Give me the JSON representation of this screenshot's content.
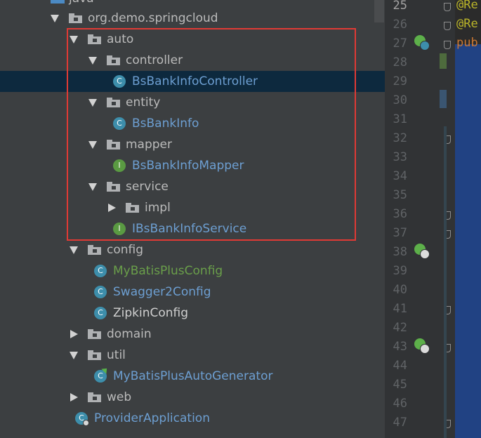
{
  "tree": {
    "top_partial": "java",
    "rows": [
      {
        "label": "org.demo.springcloud",
        "kind": "folder",
        "expanded": true,
        "indent": 0
      },
      {
        "label": "auto",
        "kind": "folder",
        "expanded": true,
        "indent": 1
      },
      {
        "label": "controller",
        "kind": "folder",
        "expanded": true,
        "indent": 2
      },
      {
        "label": "BsBankInfoController",
        "kind": "class",
        "indent": 3,
        "color": "blue",
        "selected": true
      },
      {
        "label": "entity",
        "kind": "folder",
        "expanded": true,
        "indent": 2
      },
      {
        "label": "BsBankInfo",
        "kind": "class",
        "indent": 3,
        "color": "blue"
      },
      {
        "label": "mapper",
        "kind": "folder",
        "expanded": true,
        "indent": 2
      },
      {
        "label": "BsBankInfoMapper",
        "kind": "interface",
        "indent": 3,
        "color": "blue"
      },
      {
        "label": "service",
        "kind": "folder",
        "expanded": true,
        "indent": 2
      },
      {
        "label": "impl",
        "kind": "folder",
        "expanded": false,
        "indent": 3
      },
      {
        "label": "IBsBankInfoService",
        "kind": "interface",
        "indent": 3,
        "color": "blue"
      },
      {
        "label": "config",
        "kind": "folder",
        "expanded": true,
        "indent": 1
      },
      {
        "label": "MyBatisPlusConfig",
        "kind": "class",
        "indent": 2,
        "color": "green"
      },
      {
        "label": "Swagger2Config",
        "kind": "class",
        "indent": 2,
        "color": "blue"
      },
      {
        "label": "ZipkinConfig",
        "kind": "class",
        "indent": 2,
        "color": "white"
      },
      {
        "label": "domain",
        "kind": "folder",
        "expanded": false,
        "indent": 1
      },
      {
        "label": "util",
        "kind": "folder",
        "expanded": true,
        "indent": 1
      },
      {
        "label": "MyBatisPlusAutoGenerator",
        "kind": "runnable-class",
        "indent": 2,
        "color": "blue"
      },
      {
        "label": "web",
        "kind": "folder",
        "expanded": false,
        "indent": 1
      },
      {
        "label": "ProviderApplication",
        "kind": "spring-boot-class",
        "indent": 1,
        "color": "blue"
      }
    ]
  },
  "gutter": {
    "line_numbers": [
      "25",
      "26",
      "27",
      "28",
      "29",
      "30",
      "31",
      "32",
      "33",
      "34",
      "35",
      "36",
      "37",
      "38",
      "39",
      "40",
      "41",
      "42",
      "43",
      "44",
      "45",
      "46",
      "47"
    ],
    "current_line": "25",
    "class_icon_line": "27",
    "web_icon_lines": [
      "38",
      "43"
    ]
  },
  "code": {
    "line25": "@Re",
    "line26": "@Re",
    "line27": "pub"
  },
  "colors": {
    "tree_bg": "#3c3f41",
    "selected_row": "#0d293e",
    "highlight_box": "#e03a35",
    "class_icon": "#3d8eab",
    "interface_icon": "#5a9a42",
    "label_blue": "#6d9fd2",
    "label_green": "#6a9f4a",
    "annotation": "#bbb529",
    "keyword": "#cc7832"
  },
  "icons": {
    "class": "C",
    "interface": "I"
  }
}
